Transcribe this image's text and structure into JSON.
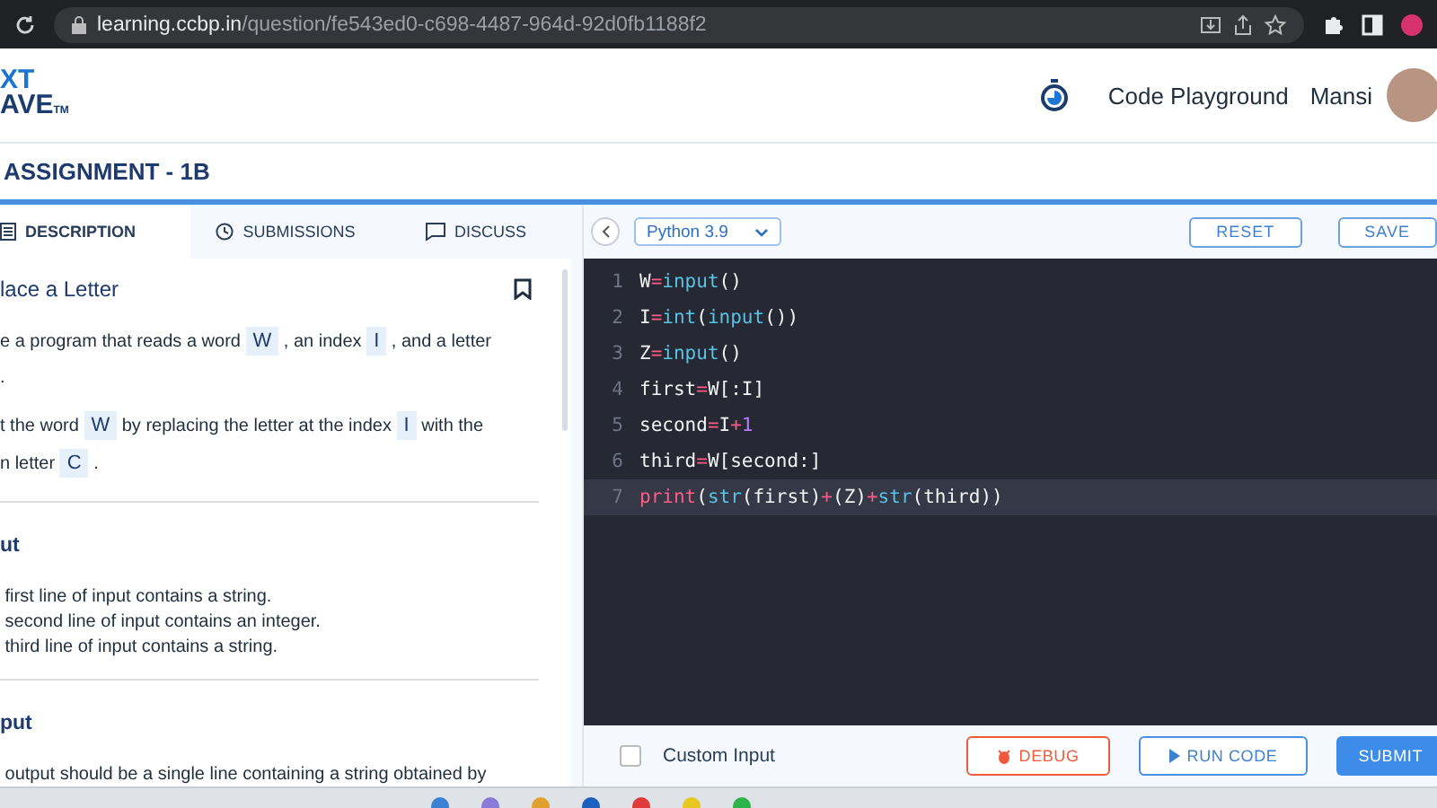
{
  "browser": {
    "url_host": "learning.ccbp.in",
    "url_path": "/question/fe543ed0-c698-4487-964d-92d0fb1188f2"
  },
  "header": {
    "logo_lines": [
      "XT",
      "AVE"
    ],
    "logo_mark": "TM",
    "nav_link": "Code Playground",
    "user_name": "Mansi"
  },
  "title_bar": {
    "title": "ASSIGNMENT - 1B"
  },
  "left_panel": {
    "tabs": [
      {
        "label": "DESCRIPTION",
        "kind": "doc",
        "selected": true
      },
      {
        "label": "SUBMISSIONS",
        "kind": "clock",
        "selected": false
      },
      {
        "label": "DISCUSS",
        "kind": "chat",
        "selected": false
      }
    ],
    "question_title": "lace a Letter",
    "paragraphs": [
      [
        {
          "kind": "text",
          "text": "e a program that reads a word "
        },
        {
          "kind": "code",
          "text": "W"
        },
        {
          "kind": "text",
          "text": " , an index "
        },
        {
          "kind": "code",
          "text": "I"
        },
        {
          "kind": "text",
          "text": " , and a letter"
        }
      ],
      [
        {
          "kind": "text",
          "text": "."
        }
      ],
      [
        {
          "kind": "text",
          "text": "t the word "
        },
        {
          "kind": "code",
          "text": "W"
        },
        {
          "kind": "text",
          "text": " by replacing the letter at the index "
        },
        {
          "kind": "code",
          "text": "I"
        },
        {
          "kind": "text",
          "text": " with the"
        }
      ],
      [
        {
          "kind": "text",
          "text": "n letter "
        },
        {
          "kind": "code",
          "text": "C"
        },
        {
          "kind": "text",
          "text": " ."
        }
      ]
    ],
    "sections": [
      {
        "heading": "ut",
        "lines": [
          "first line of input contains a string.",
          "second line of input contains an integer.",
          "third line of input contains a string."
        ]
      },
      {
        "heading": "put",
        "lines": [
          "output should be a single line containing a string obtained by"
        ]
      }
    ]
  },
  "editor": {
    "language": "Python 3.9",
    "buttons": [
      "RESET",
      "SAVE"
    ],
    "lines": [
      {
        "number": "1",
        "active": false,
        "tokens": [
          {
            "kind": "var",
            "text": "W"
          },
          {
            "kind": "op",
            "text": "="
          },
          {
            "kind": "fn",
            "text": "input"
          },
          {
            "kind": "punc",
            "text": "()"
          }
        ]
      },
      {
        "number": "2",
        "active": false,
        "tokens": [
          {
            "kind": "var",
            "text": "I"
          },
          {
            "kind": "op",
            "text": "="
          },
          {
            "kind": "fn",
            "text": "int"
          },
          {
            "kind": "punc",
            "text": "("
          },
          {
            "kind": "fn",
            "text": "input"
          },
          {
            "kind": "punc",
            "text": "())"
          }
        ]
      },
      {
        "number": "3",
        "active": false,
        "tokens": [
          {
            "kind": "var",
            "text": "Z"
          },
          {
            "kind": "op",
            "text": "="
          },
          {
            "kind": "fn",
            "text": "input"
          },
          {
            "kind": "punc",
            "text": "()"
          }
        ]
      },
      {
        "number": "4",
        "active": false,
        "tokens": [
          {
            "kind": "var",
            "text": "first"
          },
          {
            "kind": "op",
            "text": "="
          },
          {
            "kind": "var",
            "text": "W[:I]"
          }
        ]
      },
      {
        "number": "5",
        "active": false,
        "tokens": [
          {
            "kind": "var",
            "text": "second"
          },
          {
            "kind": "op",
            "text": "="
          },
          {
            "kind": "var",
            "text": "I"
          },
          {
            "kind": "op",
            "text": "+"
          },
          {
            "kind": "num",
            "text": "1"
          }
        ]
      },
      {
        "number": "6",
        "active": false,
        "tokens": [
          {
            "kind": "var",
            "text": "third"
          },
          {
            "kind": "op",
            "text": "="
          },
          {
            "kind": "var",
            "text": "W[second:]"
          }
        ]
      },
      {
        "number": "7",
        "active": true,
        "tokens": [
          {
            "kind": "kw",
            "text": "print"
          },
          {
            "kind": "punc",
            "text": "("
          },
          {
            "kind": "fn",
            "text": "str"
          },
          {
            "kind": "punc",
            "text": "(first)"
          },
          {
            "kind": "op",
            "text": "+"
          },
          {
            "kind": "punc",
            "text": "(Z)"
          },
          {
            "kind": "op",
            "text": "+"
          },
          {
            "kind": "fn",
            "text": "str"
          },
          {
            "kind": "punc",
            "text": "(third))"
          }
        ]
      }
    ]
  },
  "footer": {
    "custom_input": {
      "label": "Custom Input",
      "checked": false
    },
    "buttons": [
      {
        "kind": "debug",
        "label": "DEBUG"
      },
      {
        "kind": "run",
        "label": "RUN CODE"
      },
      {
        "kind": "submit",
        "label": "SUBMIT"
      }
    ]
  }
}
